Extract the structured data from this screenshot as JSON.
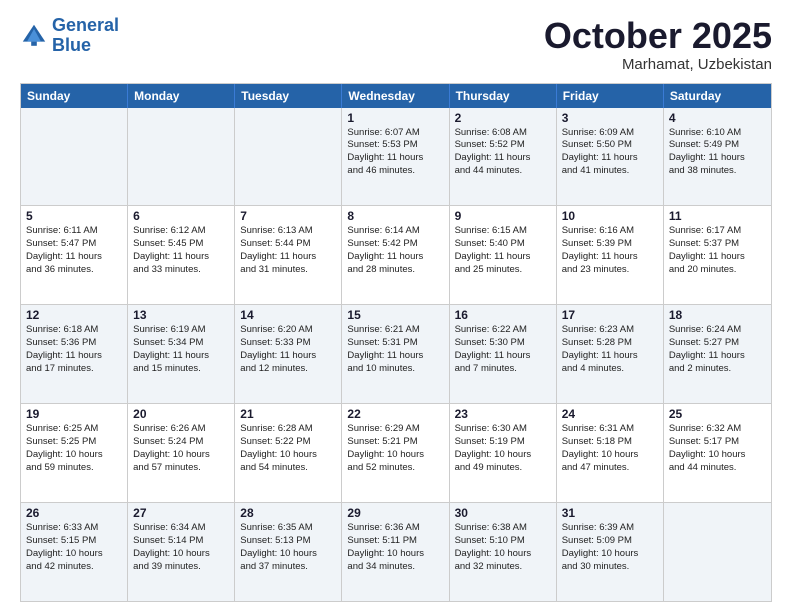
{
  "header": {
    "logo_line1": "General",
    "logo_line2": "Blue",
    "month": "October 2025",
    "location": "Marhamat, Uzbekistan"
  },
  "weekdays": [
    "Sunday",
    "Monday",
    "Tuesday",
    "Wednesday",
    "Thursday",
    "Friday",
    "Saturday"
  ],
  "rows": [
    [
      {
        "day": "",
        "lines": []
      },
      {
        "day": "",
        "lines": []
      },
      {
        "day": "",
        "lines": []
      },
      {
        "day": "1",
        "lines": [
          "Sunrise: 6:07 AM",
          "Sunset: 5:53 PM",
          "Daylight: 11 hours",
          "and 46 minutes."
        ]
      },
      {
        "day": "2",
        "lines": [
          "Sunrise: 6:08 AM",
          "Sunset: 5:52 PM",
          "Daylight: 11 hours",
          "and 44 minutes."
        ]
      },
      {
        "day": "3",
        "lines": [
          "Sunrise: 6:09 AM",
          "Sunset: 5:50 PM",
          "Daylight: 11 hours",
          "and 41 minutes."
        ]
      },
      {
        "day": "4",
        "lines": [
          "Sunrise: 6:10 AM",
          "Sunset: 5:49 PM",
          "Daylight: 11 hours",
          "and 38 minutes."
        ]
      }
    ],
    [
      {
        "day": "5",
        "lines": [
          "Sunrise: 6:11 AM",
          "Sunset: 5:47 PM",
          "Daylight: 11 hours",
          "and 36 minutes."
        ]
      },
      {
        "day": "6",
        "lines": [
          "Sunrise: 6:12 AM",
          "Sunset: 5:45 PM",
          "Daylight: 11 hours",
          "and 33 minutes."
        ]
      },
      {
        "day": "7",
        "lines": [
          "Sunrise: 6:13 AM",
          "Sunset: 5:44 PM",
          "Daylight: 11 hours",
          "and 31 minutes."
        ]
      },
      {
        "day": "8",
        "lines": [
          "Sunrise: 6:14 AM",
          "Sunset: 5:42 PM",
          "Daylight: 11 hours",
          "and 28 minutes."
        ]
      },
      {
        "day": "9",
        "lines": [
          "Sunrise: 6:15 AM",
          "Sunset: 5:40 PM",
          "Daylight: 11 hours",
          "and 25 minutes."
        ]
      },
      {
        "day": "10",
        "lines": [
          "Sunrise: 6:16 AM",
          "Sunset: 5:39 PM",
          "Daylight: 11 hours",
          "and 23 minutes."
        ]
      },
      {
        "day": "11",
        "lines": [
          "Sunrise: 6:17 AM",
          "Sunset: 5:37 PM",
          "Daylight: 11 hours",
          "and 20 minutes."
        ]
      }
    ],
    [
      {
        "day": "12",
        "lines": [
          "Sunrise: 6:18 AM",
          "Sunset: 5:36 PM",
          "Daylight: 11 hours",
          "and 17 minutes."
        ]
      },
      {
        "day": "13",
        "lines": [
          "Sunrise: 6:19 AM",
          "Sunset: 5:34 PM",
          "Daylight: 11 hours",
          "and 15 minutes."
        ]
      },
      {
        "day": "14",
        "lines": [
          "Sunrise: 6:20 AM",
          "Sunset: 5:33 PM",
          "Daylight: 11 hours",
          "and 12 minutes."
        ]
      },
      {
        "day": "15",
        "lines": [
          "Sunrise: 6:21 AM",
          "Sunset: 5:31 PM",
          "Daylight: 11 hours",
          "and 10 minutes."
        ]
      },
      {
        "day": "16",
        "lines": [
          "Sunrise: 6:22 AM",
          "Sunset: 5:30 PM",
          "Daylight: 11 hours",
          "and 7 minutes."
        ]
      },
      {
        "day": "17",
        "lines": [
          "Sunrise: 6:23 AM",
          "Sunset: 5:28 PM",
          "Daylight: 11 hours",
          "and 4 minutes."
        ]
      },
      {
        "day": "18",
        "lines": [
          "Sunrise: 6:24 AM",
          "Sunset: 5:27 PM",
          "Daylight: 11 hours",
          "and 2 minutes."
        ]
      }
    ],
    [
      {
        "day": "19",
        "lines": [
          "Sunrise: 6:25 AM",
          "Sunset: 5:25 PM",
          "Daylight: 10 hours",
          "and 59 minutes."
        ]
      },
      {
        "day": "20",
        "lines": [
          "Sunrise: 6:26 AM",
          "Sunset: 5:24 PM",
          "Daylight: 10 hours",
          "and 57 minutes."
        ]
      },
      {
        "day": "21",
        "lines": [
          "Sunrise: 6:28 AM",
          "Sunset: 5:22 PM",
          "Daylight: 10 hours",
          "and 54 minutes."
        ]
      },
      {
        "day": "22",
        "lines": [
          "Sunrise: 6:29 AM",
          "Sunset: 5:21 PM",
          "Daylight: 10 hours",
          "and 52 minutes."
        ]
      },
      {
        "day": "23",
        "lines": [
          "Sunrise: 6:30 AM",
          "Sunset: 5:19 PM",
          "Daylight: 10 hours",
          "and 49 minutes."
        ]
      },
      {
        "day": "24",
        "lines": [
          "Sunrise: 6:31 AM",
          "Sunset: 5:18 PM",
          "Daylight: 10 hours",
          "and 47 minutes."
        ]
      },
      {
        "day": "25",
        "lines": [
          "Sunrise: 6:32 AM",
          "Sunset: 5:17 PM",
          "Daylight: 10 hours",
          "and 44 minutes."
        ]
      }
    ],
    [
      {
        "day": "26",
        "lines": [
          "Sunrise: 6:33 AM",
          "Sunset: 5:15 PM",
          "Daylight: 10 hours",
          "and 42 minutes."
        ]
      },
      {
        "day": "27",
        "lines": [
          "Sunrise: 6:34 AM",
          "Sunset: 5:14 PM",
          "Daylight: 10 hours",
          "and 39 minutes."
        ]
      },
      {
        "day": "28",
        "lines": [
          "Sunrise: 6:35 AM",
          "Sunset: 5:13 PM",
          "Daylight: 10 hours",
          "and 37 minutes."
        ]
      },
      {
        "day": "29",
        "lines": [
          "Sunrise: 6:36 AM",
          "Sunset: 5:11 PM",
          "Daylight: 10 hours",
          "and 34 minutes."
        ]
      },
      {
        "day": "30",
        "lines": [
          "Sunrise: 6:38 AM",
          "Sunset: 5:10 PM",
          "Daylight: 10 hours",
          "and 32 minutes."
        ]
      },
      {
        "day": "31",
        "lines": [
          "Sunrise: 6:39 AM",
          "Sunset: 5:09 PM",
          "Daylight: 10 hours",
          "and 30 minutes."
        ]
      },
      {
        "day": "",
        "lines": []
      }
    ]
  ]
}
